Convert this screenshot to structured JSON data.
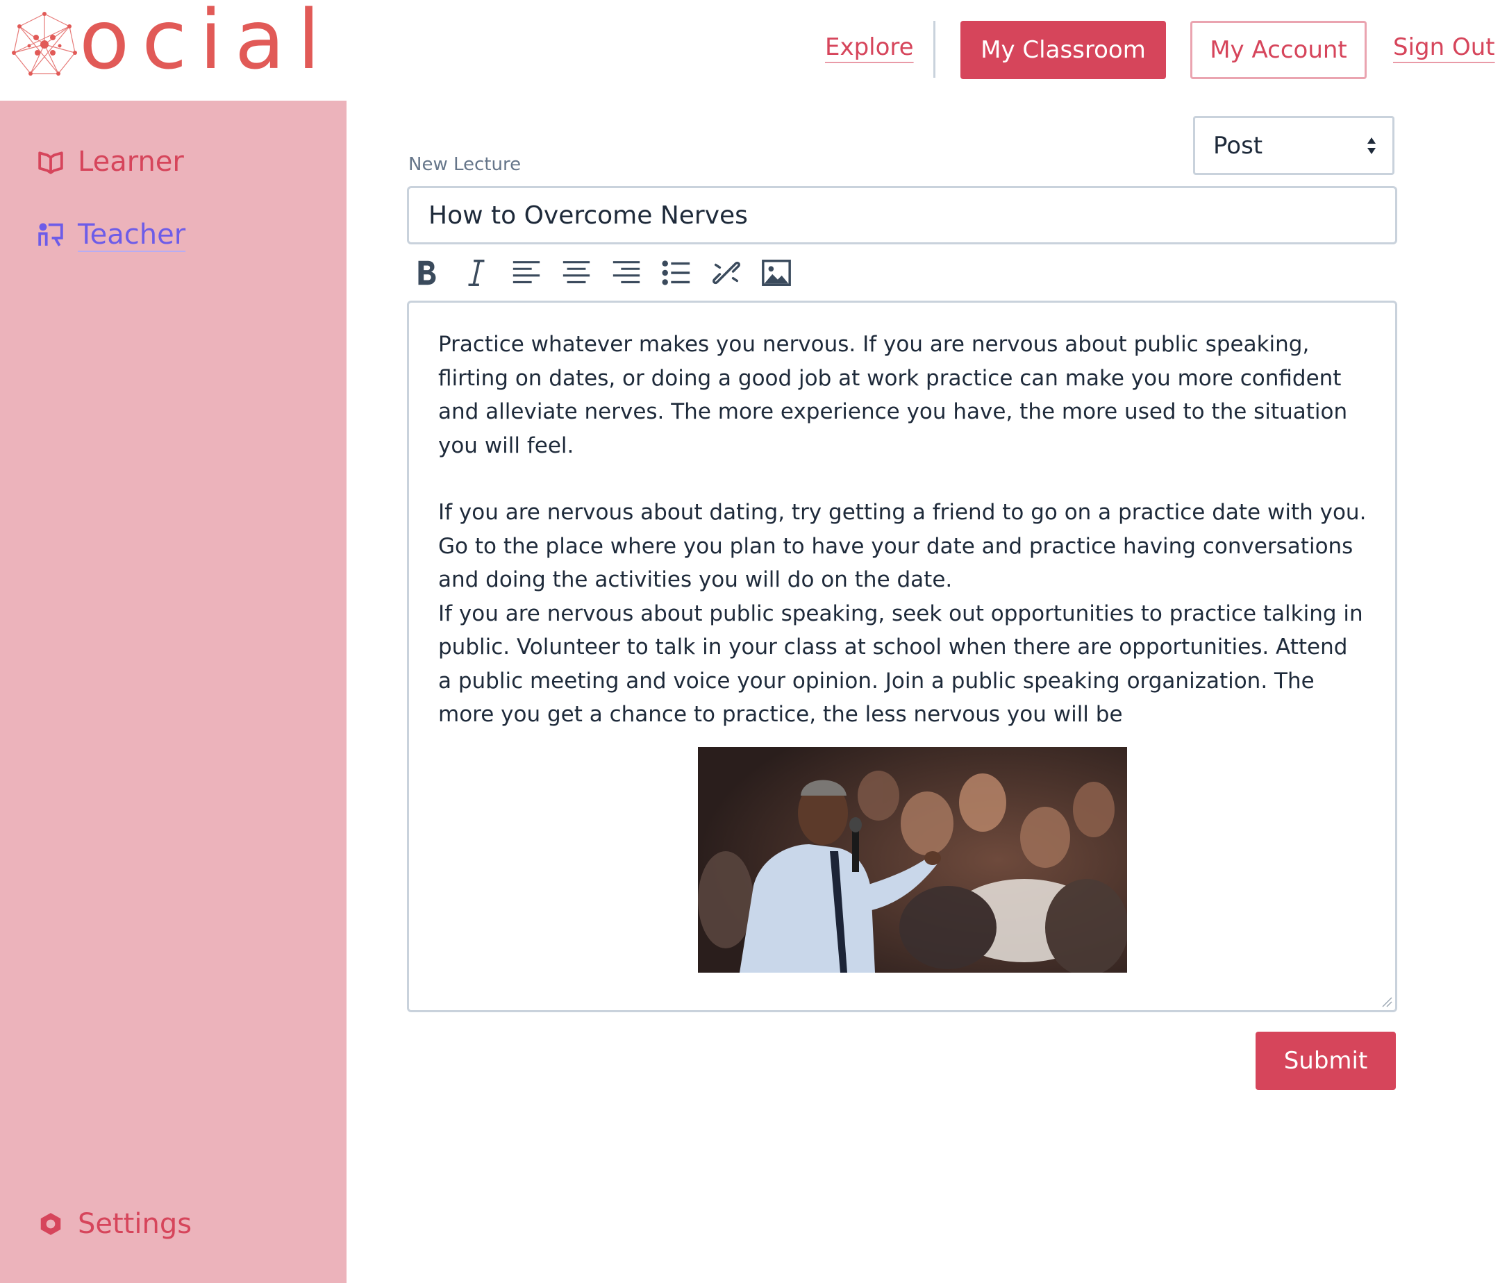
{
  "brand": {
    "wordmark": "ocial",
    "color": "#e15a57"
  },
  "header": {
    "explore": "Explore",
    "my_classroom": "My Classroom",
    "my_account": "My Account",
    "sign_out": "Sign Out"
  },
  "sidebar": {
    "items": [
      {
        "label": "Learner",
        "icon": "book-open-icon"
      },
      {
        "label": "Teacher",
        "icon": "teacher-board-icon",
        "active": true
      }
    ],
    "settings": {
      "label": "Settings",
      "icon": "gear-icon"
    }
  },
  "editor": {
    "post_type": {
      "selected": "Post"
    },
    "section_label": "New Lecture",
    "title_value": "How to Overcome Nerves",
    "toolbar": [
      "bold-icon",
      "italic-icon",
      "align-left-icon",
      "align-center-icon",
      "align-right-icon",
      "bulleted-list-icon",
      "unlink-icon",
      "image-icon"
    ],
    "paragraphs": [
      "Practice whatever makes you nervous. If you are nervous about public speaking, flirting on dates, or doing a good job at work practice can make you more confident and alleviate nerves. The more experience you have, the more used to the situation you will feel.",
      "If you are nervous about dating, try getting a friend to go on a practice date with you. Go to the place where you plan to have your date and practice having conversations and doing the activities you will do on the date.",
      "If you are nervous about public speaking, seek out opportunities to practice talking in public. Volunteer to talk in your class at school when there are opportunities. Attend a public meeting and voice your opinion. Join a public speaking organization. The more you get a chance to practice, the less nervous you will be"
    ],
    "submit": "Submit"
  },
  "colors": {
    "accent": "#d6455b",
    "sidebar_bg": "#ecb3bb",
    "active_link": "#6d5ce8",
    "border": "#c9d2dc"
  }
}
